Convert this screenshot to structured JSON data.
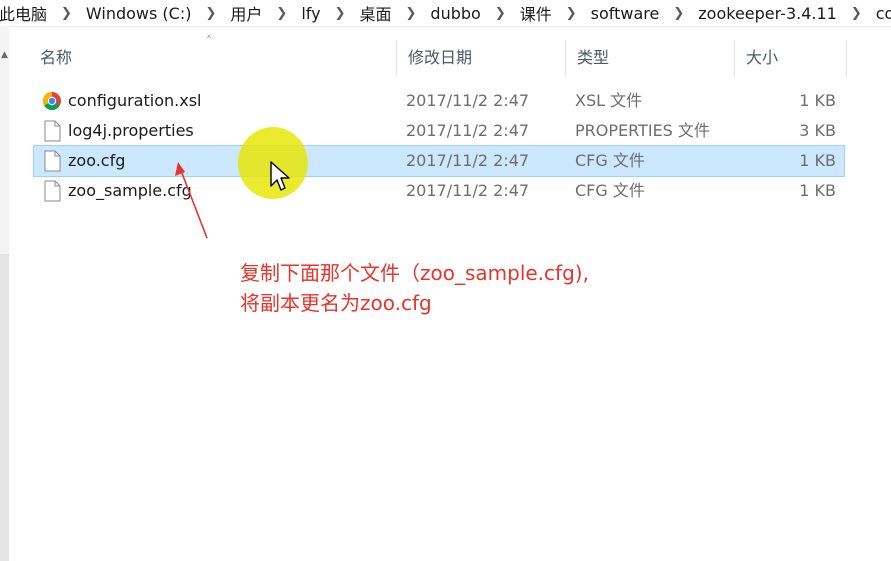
{
  "breadcrumb": [
    "此电脑",
    "Windows (C:)",
    "用户",
    "lfy",
    "桌面",
    "dubbo",
    "课件",
    "software",
    "zookeeper-3.4.11",
    "con"
  ],
  "columns": {
    "name": "名称",
    "date": "修改日期",
    "type": "类型",
    "size": "大小"
  },
  "files": [
    {
      "name": "configuration.xsl",
      "date": "2017/11/2 2:47",
      "type": "XSL 文件",
      "size": "1 KB",
      "icon": "chrome-icon"
    },
    {
      "name": "log4j.properties",
      "date": "2017/11/2 2:47",
      "type": "PROPERTIES 文件",
      "size": "3 KB",
      "icon": "file-icon"
    },
    {
      "name": "zoo.cfg",
      "date": "2017/11/2 2:47",
      "type": "CFG 文件",
      "size": "1 KB",
      "icon": "file-icon",
      "selected": true
    },
    {
      "name": "zoo_sample.cfg",
      "date": "2017/11/2 2:47",
      "type": "CFG 文件",
      "size": "1 KB",
      "icon": "file-icon"
    }
  ],
  "annotation": {
    "line1": "复制下面那个文件（zoo_sample.cfg),",
    "line2": "将副本更名为zoo.cfg",
    "color": "#e8342a"
  },
  "colors": {
    "selection": "#cce8ff",
    "highlight": "#e6e600"
  }
}
